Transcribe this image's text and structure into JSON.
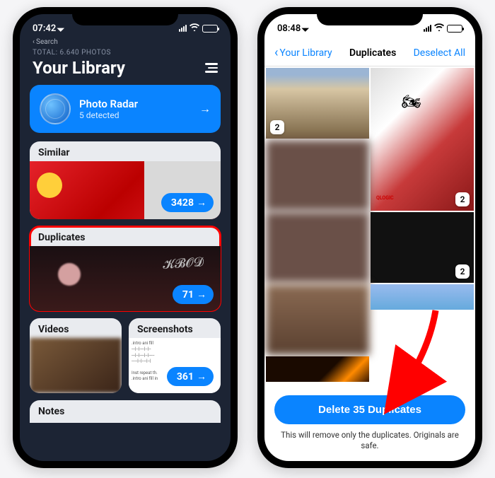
{
  "left": {
    "status": {
      "time": "07:42",
      "back_label": "Search"
    },
    "library": {
      "total_label": "TOTAL: 6.640 PHOTOS",
      "title": "Your Library"
    },
    "radar": {
      "title": "Photo Radar",
      "subtitle": "5 detected"
    },
    "sections": {
      "similar": {
        "label": "Similar",
        "count": "3428"
      },
      "duplicates": {
        "label": "Duplicates",
        "count": "71"
      },
      "videos": {
        "label": "Videos"
      },
      "screenshots": {
        "label": "Screenshots",
        "count": "361"
      },
      "notes": {
        "label": "Notes"
      }
    }
  },
  "right": {
    "status": {
      "time": "08:48"
    },
    "nav": {
      "back": "Your Library",
      "title": "Duplicates",
      "action": "Deselect All"
    },
    "badges": {
      "b1": "2",
      "b2": "2",
      "b3": "2"
    },
    "qlogic": "QLOGIC",
    "delete_button": "Delete 35 Duplicates",
    "hint": "This will remove only the duplicates. Originals are safe."
  }
}
